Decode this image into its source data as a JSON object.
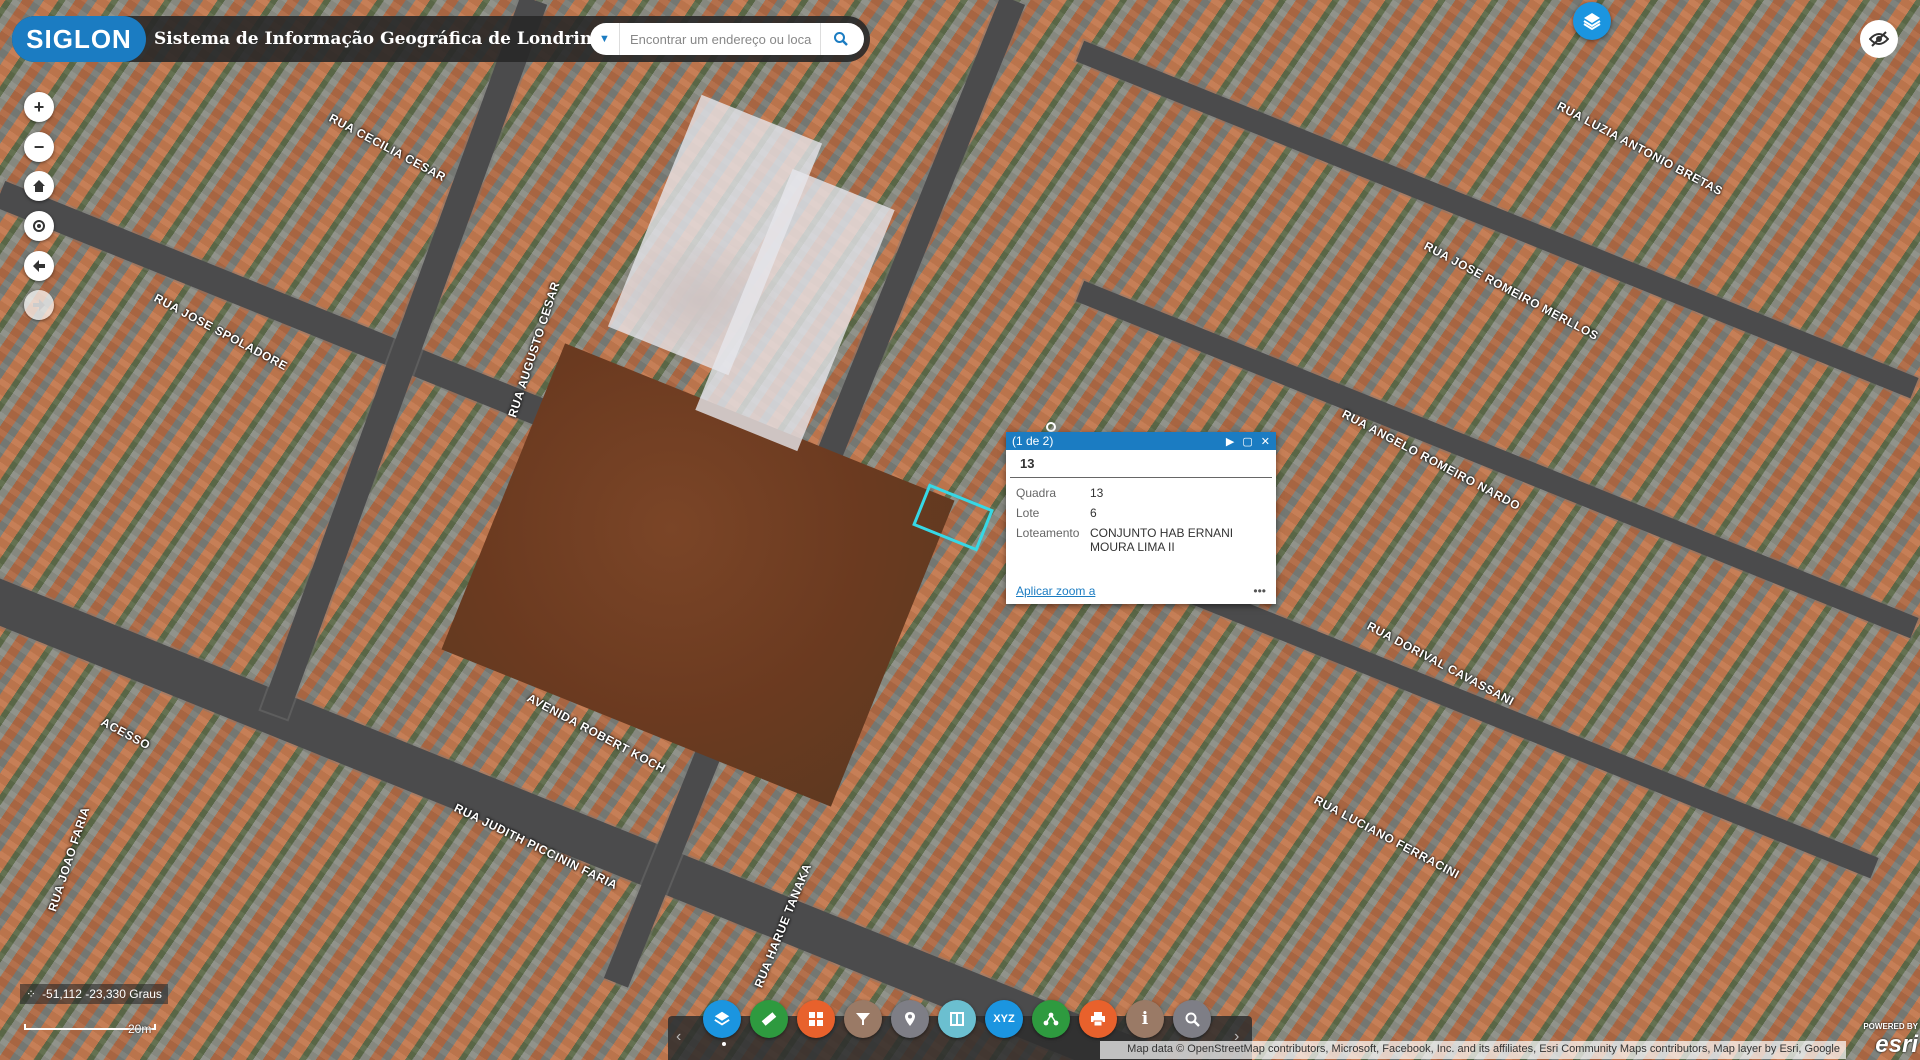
{
  "header": {
    "logo_text": "SIGLON",
    "app_title": "Sistema de Informação Geográfica de Londrina",
    "search_placeholder": "Encontrar um endereço ou loca"
  },
  "map": {
    "street_labels": [
      "RUA CECILIA CESAR",
      "RUA JOSE SPOLADORE",
      "RUA AUGUSTO CESAR",
      "RUA LUZIA ANTONIO BRETAS",
      "RUA JOSE ROMEIRO MERLLOS",
      "RUA ANGELO ROMEIRO NARDO",
      "RUA DORIVAL CAVASSANI",
      "RUA LUCIANO FERRACINI",
      "AVENIDA ROBERT KOCH",
      "RUA JUDITH PICCININ FARIA",
      "RUA HARUE TANAKA",
      "RUA JOAO FARIA",
      "ACESSO"
    ]
  },
  "popup": {
    "counter": "(1 de 2)",
    "title": "13",
    "fields": [
      {
        "key": "Quadra",
        "value": "13"
      },
      {
        "key": "Lote",
        "value": "6"
      },
      {
        "key": "Loteamento",
        "value": "CONJUNTO HAB ERNANI MOURA LIMA II"
      }
    ],
    "zoom_link": "Aplicar zoom a",
    "more": "•••"
  },
  "toolbar": {
    "colors": [
      "#1b95e0",
      "#2e9a3f",
      "#e8612c",
      "#9a7a66",
      "#7e7e86",
      "#6bbfd0",
      "#1b95e0",
      "#2e9a3f",
      "#e8612c",
      "#9a7a66",
      "#7e7e86"
    ],
    "icons": [
      "layers-icon",
      "measure-icon",
      "basemap-gallery-icon",
      "filter-icon",
      "location-icon",
      "swipe-icon",
      "xyz-coordinate-icon",
      "share-icon",
      "print-icon",
      "info-icon",
      "search-layer-icon"
    ],
    "xyz_label": "XYZ"
  },
  "status": {
    "coordinates": "-51,112 -23,330 Graus",
    "scale_label": "20m",
    "attribution": "Map data © OpenStreetMap contributors, Microsoft, Facebook, Inc. and its affiliates, Esri Community Maps contributors, Map layer by Esri, Google",
    "esri_powered": "POWERED BY",
    "esri_brand": "esri"
  }
}
